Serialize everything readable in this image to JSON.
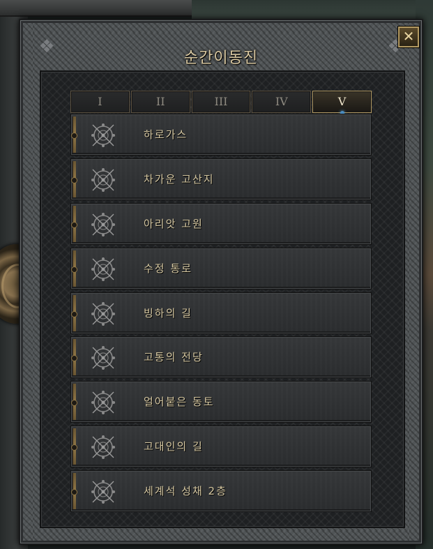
{
  "window": {
    "title": "순간이동진",
    "close_icon": "close-icon",
    "close_glyph": "✕"
  },
  "tabs": [
    {
      "label": "I",
      "active": false
    },
    {
      "label": "II",
      "active": false
    },
    {
      "label": "III",
      "active": false
    },
    {
      "label": "IV",
      "active": false
    },
    {
      "label": "V",
      "active": true
    }
  ],
  "destinations": [
    {
      "label": "하로가스",
      "icon": "waypoint-rune-icon"
    },
    {
      "label": "차가운 고산지",
      "icon": "waypoint-rune-icon"
    },
    {
      "label": "아리앗 고원",
      "icon": "waypoint-rune-icon"
    },
    {
      "label": "수정 통로",
      "icon": "waypoint-rune-icon"
    },
    {
      "label": "빙하의 길",
      "icon": "waypoint-rune-icon"
    },
    {
      "label": "고통의 전당",
      "icon": "waypoint-rune-icon"
    },
    {
      "label": "얼어붙은 동토",
      "icon": "waypoint-rune-icon"
    },
    {
      "label": "고대인의 길",
      "icon": "waypoint-rune-icon"
    },
    {
      "label": "세계석 성채 2층",
      "icon": "waypoint-rune-icon"
    }
  ],
  "colors": {
    "text_gold": "#d6c8a2",
    "frame_gold": "#b39a62",
    "active_dot": "#4a8cc0"
  }
}
